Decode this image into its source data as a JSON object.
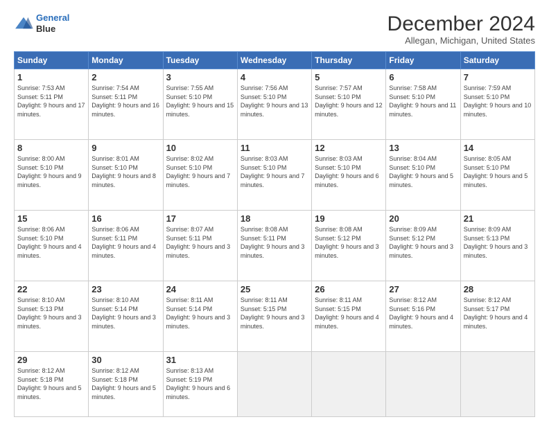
{
  "logo": {
    "line1": "General",
    "line2": "Blue"
  },
  "title": "December 2024",
  "subtitle": "Allegan, Michigan, United States",
  "days_of_week": [
    "Sunday",
    "Monday",
    "Tuesday",
    "Wednesday",
    "Thursday",
    "Friday",
    "Saturday"
  ],
  "weeks": [
    [
      {
        "day": "1",
        "info": "Sunrise: 7:53 AM\nSunset: 5:11 PM\nDaylight: 9 hours and 17 minutes."
      },
      {
        "day": "2",
        "info": "Sunrise: 7:54 AM\nSunset: 5:11 PM\nDaylight: 9 hours and 16 minutes."
      },
      {
        "day": "3",
        "info": "Sunrise: 7:55 AM\nSunset: 5:10 PM\nDaylight: 9 hours and 15 minutes."
      },
      {
        "day": "4",
        "info": "Sunrise: 7:56 AM\nSunset: 5:10 PM\nDaylight: 9 hours and 13 minutes."
      },
      {
        "day": "5",
        "info": "Sunrise: 7:57 AM\nSunset: 5:10 PM\nDaylight: 9 hours and 12 minutes."
      },
      {
        "day": "6",
        "info": "Sunrise: 7:58 AM\nSunset: 5:10 PM\nDaylight: 9 hours and 11 minutes."
      },
      {
        "day": "7",
        "info": "Sunrise: 7:59 AM\nSunset: 5:10 PM\nDaylight: 9 hours and 10 minutes."
      }
    ],
    [
      {
        "day": "8",
        "info": "Sunrise: 8:00 AM\nSunset: 5:10 PM\nDaylight: 9 hours and 9 minutes."
      },
      {
        "day": "9",
        "info": "Sunrise: 8:01 AM\nSunset: 5:10 PM\nDaylight: 9 hours and 8 minutes."
      },
      {
        "day": "10",
        "info": "Sunrise: 8:02 AM\nSunset: 5:10 PM\nDaylight: 9 hours and 7 minutes."
      },
      {
        "day": "11",
        "info": "Sunrise: 8:03 AM\nSunset: 5:10 PM\nDaylight: 9 hours and 7 minutes."
      },
      {
        "day": "12",
        "info": "Sunrise: 8:03 AM\nSunset: 5:10 PM\nDaylight: 9 hours and 6 minutes."
      },
      {
        "day": "13",
        "info": "Sunrise: 8:04 AM\nSunset: 5:10 PM\nDaylight: 9 hours and 5 minutes."
      },
      {
        "day": "14",
        "info": "Sunrise: 8:05 AM\nSunset: 5:10 PM\nDaylight: 9 hours and 5 minutes."
      }
    ],
    [
      {
        "day": "15",
        "info": "Sunrise: 8:06 AM\nSunset: 5:10 PM\nDaylight: 9 hours and 4 minutes."
      },
      {
        "day": "16",
        "info": "Sunrise: 8:06 AM\nSunset: 5:11 PM\nDaylight: 9 hours and 4 minutes."
      },
      {
        "day": "17",
        "info": "Sunrise: 8:07 AM\nSunset: 5:11 PM\nDaylight: 9 hours and 3 minutes."
      },
      {
        "day": "18",
        "info": "Sunrise: 8:08 AM\nSunset: 5:11 PM\nDaylight: 9 hours and 3 minutes."
      },
      {
        "day": "19",
        "info": "Sunrise: 8:08 AM\nSunset: 5:12 PM\nDaylight: 9 hours and 3 minutes."
      },
      {
        "day": "20",
        "info": "Sunrise: 8:09 AM\nSunset: 5:12 PM\nDaylight: 9 hours and 3 minutes."
      },
      {
        "day": "21",
        "info": "Sunrise: 8:09 AM\nSunset: 5:13 PM\nDaylight: 9 hours and 3 minutes."
      }
    ],
    [
      {
        "day": "22",
        "info": "Sunrise: 8:10 AM\nSunset: 5:13 PM\nDaylight: 9 hours and 3 minutes."
      },
      {
        "day": "23",
        "info": "Sunrise: 8:10 AM\nSunset: 5:14 PM\nDaylight: 9 hours and 3 minutes."
      },
      {
        "day": "24",
        "info": "Sunrise: 8:11 AM\nSunset: 5:14 PM\nDaylight: 9 hours and 3 minutes."
      },
      {
        "day": "25",
        "info": "Sunrise: 8:11 AM\nSunset: 5:15 PM\nDaylight: 9 hours and 3 minutes."
      },
      {
        "day": "26",
        "info": "Sunrise: 8:11 AM\nSunset: 5:15 PM\nDaylight: 9 hours and 4 minutes."
      },
      {
        "day": "27",
        "info": "Sunrise: 8:12 AM\nSunset: 5:16 PM\nDaylight: 9 hours and 4 minutes."
      },
      {
        "day": "28",
        "info": "Sunrise: 8:12 AM\nSunset: 5:17 PM\nDaylight: 9 hours and 4 minutes."
      }
    ],
    [
      {
        "day": "29",
        "info": "Sunrise: 8:12 AM\nSunset: 5:18 PM\nDaylight: 9 hours and 5 minutes."
      },
      {
        "day": "30",
        "info": "Sunrise: 8:12 AM\nSunset: 5:18 PM\nDaylight: 9 hours and 5 minutes."
      },
      {
        "day": "31",
        "info": "Sunrise: 8:13 AM\nSunset: 5:19 PM\nDaylight: 9 hours and 6 minutes."
      },
      {
        "day": "",
        "info": ""
      },
      {
        "day": "",
        "info": ""
      },
      {
        "day": "",
        "info": ""
      },
      {
        "day": "",
        "info": ""
      }
    ]
  ]
}
